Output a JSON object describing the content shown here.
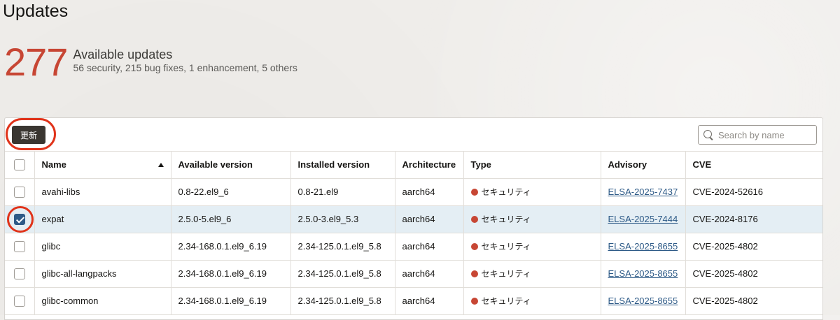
{
  "page": {
    "title": "Updates"
  },
  "summary": {
    "count": "277",
    "label": "Available updates",
    "detail": "56 security, 215 bug fixes, 1 enhancement, 5 others"
  },
  "toolbar": {
    "refresh_label": "更新",
    "search_placeholder": "Search by name"
  },
  "table": {
    "columns": [
      "Name",
      "Available version",
      "Installed version",
      "Architecture",
      "Type",
      "Advisory",
      "CVE"
    ],
    "rows": [
      {
        "name": "avahi-libs",
        "available": "0.8-22.el9_6",
        "installed": "0.8-21.el9",
        "arch": "aarch64",
        "type": "セキュリティ",
        "advisory": "ELSA-2025-7437",
        "cve": "CVE-2024-52616",
        "selected": false
      },
      {
        "name": "expat",
        "available": "2.5.0-5.el9_6",
        "installed": "2.5.0-3.el9_5.3",
        "arch": "aarch64",
        "type": "セキュリティ",
        "advisory": "ELSA-2025-7444",
        "cve": "CVE-2024-8176",
        "selected": true
      },
      {
        "name": "glibc",
        "available": "2.34-168.0.1.el9_6.19",
        "installed": "2.34-125.0.1.el9_5.8",
        "arch": "aarch64",
        "type": "セキュリティ",
        "advisory": "ELSA-2025-8655",
        "cve": "CVE-2025-4802",
        "selected": false
      },
      {
        "name": "glibc-all-langpacks",
        "available": "2.34-168.0.1.el9_6.19",
        "installed": "2.34-125.0.1.el9_5.8",
        "arch": "aarch64",
        "type": "セキュリティ",
        "advisory": "ELSA-2025-8655",
        "cve": "CVE-2025-4802",
        "selected": false
      },
      {
        "name": "glibc-common",
        "available": "2.34-168.0.1.el9_6.19",
        "installed": "2.34-125.0.1.el9_5.8",
        "arch": "aarch64",
        "type": "セキュリティ",
        "advisory": "ELSA-2025-8655",
        "cve": "CVE-2025-4802",
        "selected": false
      }
    ]
  },
  "colors": {
    "accent": "#c74634",
    "security_dot": "#c74634",
    "link": "#2d5a87",
    "highlight_ring": "#e0331a",
    "selected_row": "#e4eef4"
  },
  "icons": [
    "search-icon",
    "sort-ascending-icon",
    "checkbox-icon",
    "status-dot-icon"
  ]
}
